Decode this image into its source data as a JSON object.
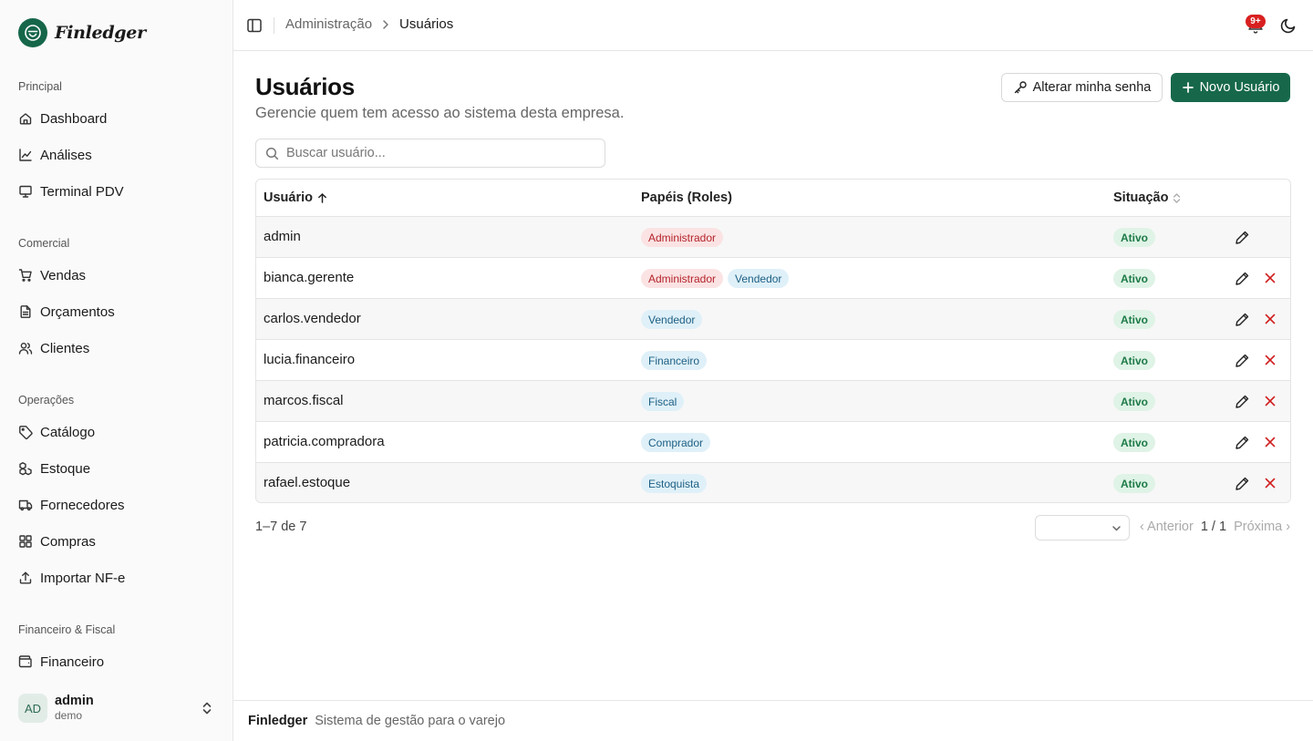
{
  "app": {
    "name": "Finledger"
  },
  "sidebar": {
    "groups": [
      {
        "label": "Principal",
        "items": [
          {
            "label": "Dashboard",
            "icon": "home-icon"
          },
          {
            "label": "Análises",
            "icon": "line-chart-icon"
          },
          {
            "label": "Terminal PDV",
            "icon": "monitor-icon"
          }
        ]
      },
      {
        "label": "Comercial",
        "items": [
          {
            "label": "Vendas",
            "icon": "shopping-cart-icon"
          },
          {
            "label": "Orçamentos",
            "icon": "file-text-icon"
          },
          {
            "label": "Clientes",
            "icon": "users-icon"
          }
        ]
      },
      {
        "label": "Operações",
        "items": [
          {
            "label": "Catálogo",
            "icon": "tag-icon"
          },
          {
            "label": "Estoque",
            "icon": "boxes-icon"
          },
          {
            "label": "Fornecedores",
            "icon": "truck-icon"
          },
          {
            "label": "Compras",
            "icon": "grid-icon"
          },
          {
            "label": "Importar NF-e",
            "icon": "upload-icon"
          }
        ]
      },
      {
        "label": "Financeiro & Fiscal",
        "items": [
          {
            "label": "Financeiro",
            "icon": "wallet-icon"
          }
        ]
      }
    ],
    "user": {
      "initials": "AD",
      "name": "admin",
      "tenant": "demo"
    }
  },
  "header": {
    "breadcrumb": [
      "Administração",
      "Usuários"
    ],
    "notifications_badge": "9+"
  },
  "page": {
    "title": "Usuários",
    "subtitle": "Gerencie quem tem acesso ao sistema desta empresa.",
    "change_password_label": "Alterar minha senha",
    "new_user_label": "Novo Usuário",
    "search_placeholder": "Buscar usuário...",
    "search_value": ""
  },
  "table": {
    "columns": {
      "user": "Usuário",
      "roles": "Papéis (Roles)",
      "status": "Situação"
    },
    "rows": [
      {
        "user": "admin",
        "roles": [
          {
            "label": "Administrador",
            "kind": "admin"
          }
        ],
        "status": "Ativo",
        "deletable": false
      },
      {
        "user": "bianca.gerente",
        "roles": [
          {
            "label": "Administrador",
            "kind": "admin"
          },
          {
            "label": "Vendedor",
            "kind": "role"
          }
        ],
        "status": "Ativo",
        "deletable": true
      },
      {
        "user": "carlos.vendedor",
        "roles": [
          {
            "label": "Vendedor",
            "kind": "role"
          }
        ],
        "status": "Ativo",
        "deletable": true
      },
      {
        "user": "lucia.financeiro",
        "roles": [
          {
            "label": "Financeiro",
            "kind": "role"
          }
        ],
        "status": "Ativo",
        "deletable": true
      },
      {
        "user": "marcos.fiscal",
        "roles": [
          {
            "label": "Fiscal",
            "kind": "role"
          }
        ],
        "status": "Ativo",
        "deletable": true
      },
      {
        "user": "patricia.compradora",
        "roles": [
          {
            "label": "Comprador",
            "kind": "role"
          }
        ],
        "status": "Ativo",
        "deletable": true
      },
      {
        "user": "rafael.estoque",
        "roles": [
          {
            "label": "Estoquista",
            "kind": "role"
          }
        ],
        "status": "Ativo",
        "deletable": true
      }
    ]
  },
  "pagination": {
    "range": "1–7 de 7",
    "page_size_value": "",
    "prev_label": "‹ Anterior",
    "current": "1 / 1",
    "next_label": "Próxima ›"
  },
  "footer": {
    "brand": "Finledger",
    "tagline": "Sistema de gestão para o varejo"
  },
  "colors": {
    "primary": "#17684b",
    "admin_badge_bg": "#fbe3e3",
    "admin_badge_fg": "#b4232b",
    "role_badge_bg": "#dff0f8",
    "role_badge_fg": "#1d5f84",
    "status_badge_bg": "#dff3e6",
    "status_badge_fg": "#1d7a47",
    "delete": "#d11f1f",
    "notification": "#d92020"
  }
}
